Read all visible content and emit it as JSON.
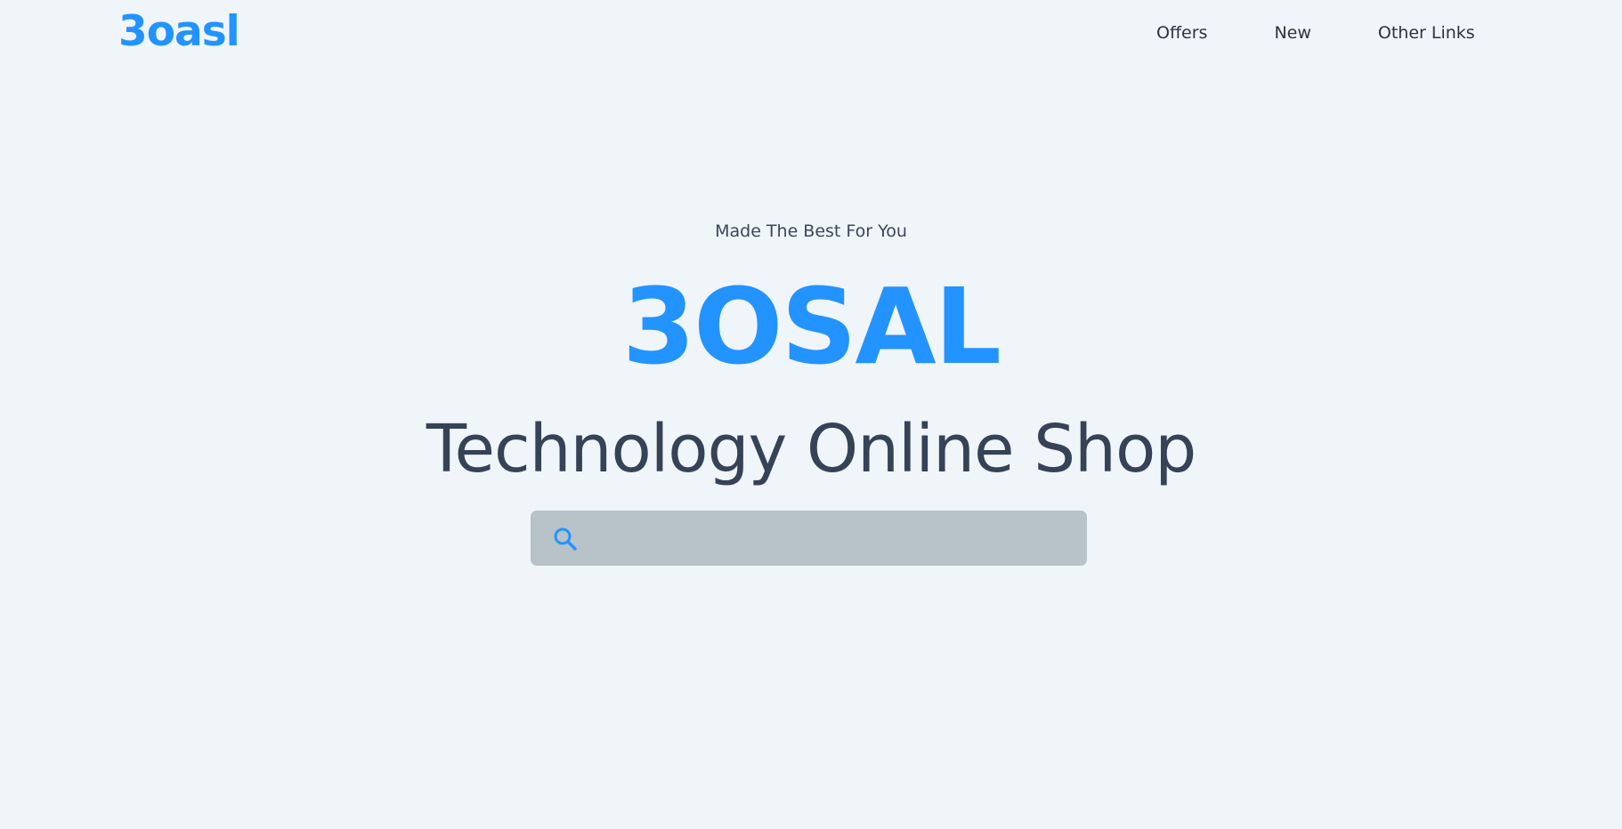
{
  "navbar": {
    "logo": "3oasl",
    "links": [
      {
        "label": "Offers"
      },
      {
        "label": "New"
      },
      {
        "label": "Other Links"
      }
    ]
  },
  "hero": {
    "tagline": "Made The Best For You",
    "brand": "3OSAL",
    "subtitle": "Technology Online Shop"
  },
  "search": {
    "value": "",
    "placeholder": "",
    "icon": "search-icon"
  },
  "colors": {
    "background": "#eff5f8",
    "accent": "#2393ff",
    "text": "#364257",
    "search_bg": "#b7c2c9"
  }
}
